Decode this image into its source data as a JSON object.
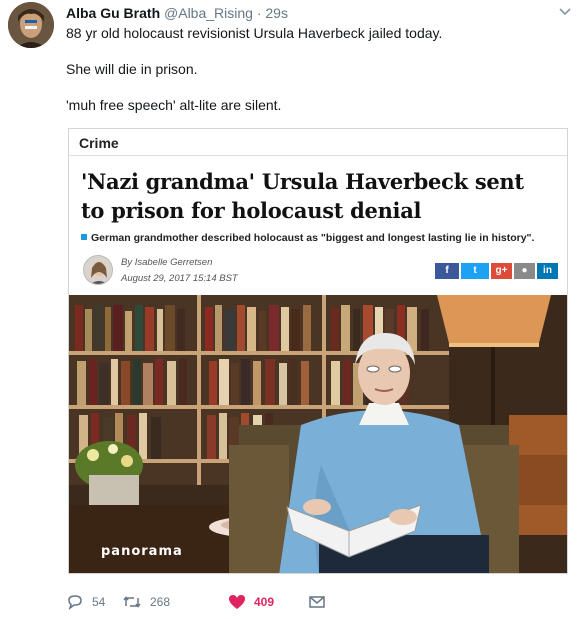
{
  "tweet": {
    "display_name": "Alba Gu Brath",
    "handle": "@Alba_Rising",
    "separator": "·",
    "time": "29s",
    "lines": [
      "88 yr old holocaust revisionist Ursula Haverbeck jailed today.",
      "She will die in prison.",
      "'muh free speech' alt-lite are silent."
    ]
  },
  "article": {
    "section": "Crime",
    "headline": "'Nazi grandma' Ursula Haverbeck sent to prison for holocaust denial",
    "standfirst": "German grandmother described holocaust as \"biggest and longest lasting lie in history\".",
    "byline": "By Isabelle Gerretsen",
    "date": "August 29, 2017 15:14 BST",
    "share_buttons": [
      "f",
      "t",
      "g+",
      "reddit",
      "in"
    ],
    "watermark": "panorama"
  },
  "actions": {
    "reply_count": "54",
    "retweet_count": "268",
    "like_count": "409",
    "like_color": "#e0245e"
  }
}
